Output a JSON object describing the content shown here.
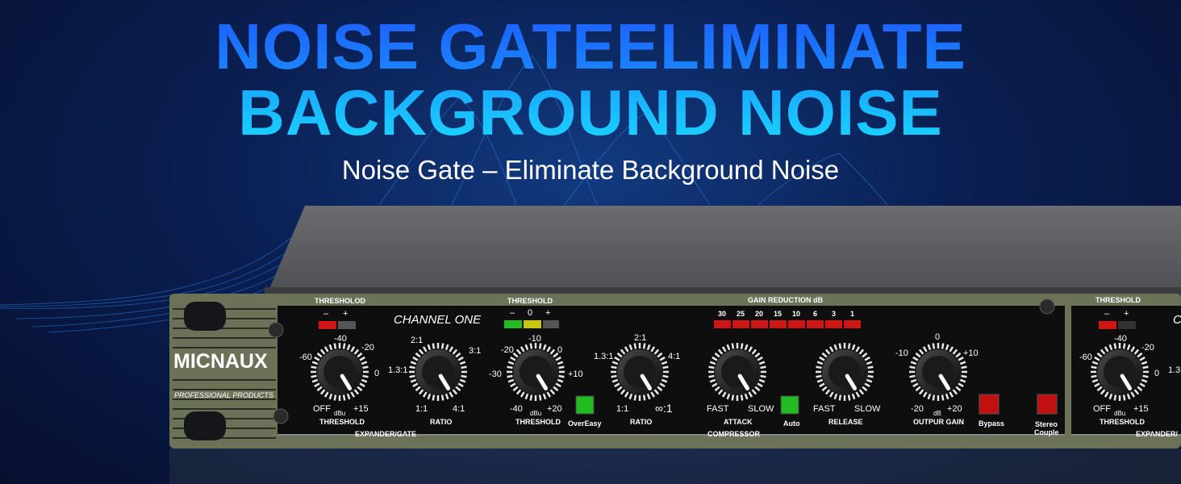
{
  "headline": {
    "line1": "NOISE GATEELIMINATE",
    "line2": "BACKGROUND NOISE",
    "subtitle": "Noise Gate – Eliminate Background Noise"
  },
  "brand": {
    "name": "MICNAUX",
    "tagline": "PROFESSIONAL PRODUCTS"
  },
  "channel_label": "CHANNEL ONE",
  "colors": {
    "accent_blue": "#1a8bff",
    "panel": "#6b7258",
    "led_red": "#d01515",
    "led_green": "#22bb22",
    "led_yellow": "#c8c80a"
  },
  "expander": {
    "led_title": "THRESHOLOD",
    "led_minus": "–",
    "led_plus": "+",
    "threshold": {
      "label": "THRESHOLD",
      "unit": "dBu",
      "scale": [
        "-40",
        "-20",
        "-60",
        "0",
        "OFF",
        "+15"
      ]
    },
    "ratio": {
      "label": "RATIO",
      "scale": [
        "2:1",
        "3:1",
        "1.3:1",
        "1:1",
        "4:1"
      ]
    },
    "section_label": "EXPANDER/GATE"
  },
  "compressor": {
    "led_title": "THRESHOLD",
    "led_minus": "–",
    "led_zero": "0",
    "led_plus": "+",
    "threshold": {
      "label": "THRESHOLD",
      "unit": "dBu",
      "scale": [
        "-10",
        "-20",
        "0",
        "-30",
        "+10",
        "-40",
        "+20"
      ]
    },
    "overeasy": "OverEasy",
    "ratio": {
      "label": "RATIO",
      "scale": [
        "2:1",
        "1.3:1",
        "4:1",
        "1:1",
        "∞:1"
      ]
    },
    "gain_reduction": {
      "title": "GAIN REDUCTION dB",
      "steps": [
        "30",
        "25",
        "20",
        "15",
        "10",
        "6",
        "3",
        "1"
      ]
    },
    "attack": {
      "label": "ATTACK",
      "fast": "FAST",
      "slow": "SLOW"
    },
    "auto": "Auto",
    "release": {
      "label": "RELEASE",
      "fast": "FAST",
      "slow": "SLOW"
    },
    "output_gain": {
      "label": "OUTPUR GAIN",
      "unit": "dB",
      "scale": [
        "0",
        "-10",
        "+10",
        "-20",
        "+20"
      ]
    },
    "bypass": "Bypass",
    "section_label": "COMPRESSOR"
  },
  "stereo_couple": {
    "line1": "Stereo",
    "line2": "Couple"
  },
  "channel_two": {
    "led_title": "THRESHOLD",
    "led_minus": "–",
    "led_plus": "+",
    "threshold": {
      "label": "THRESHOLD",
      "unit": "dBu",
      "scale": [
        "-40",
        "-20",
        "-60",
        "0",
        "OFF",
        "+15"
      ]
    },
    "scale_partial": "1.3",
    "channel_partial": "C",
    "section_label": "EXPANDER/"
  }
}
